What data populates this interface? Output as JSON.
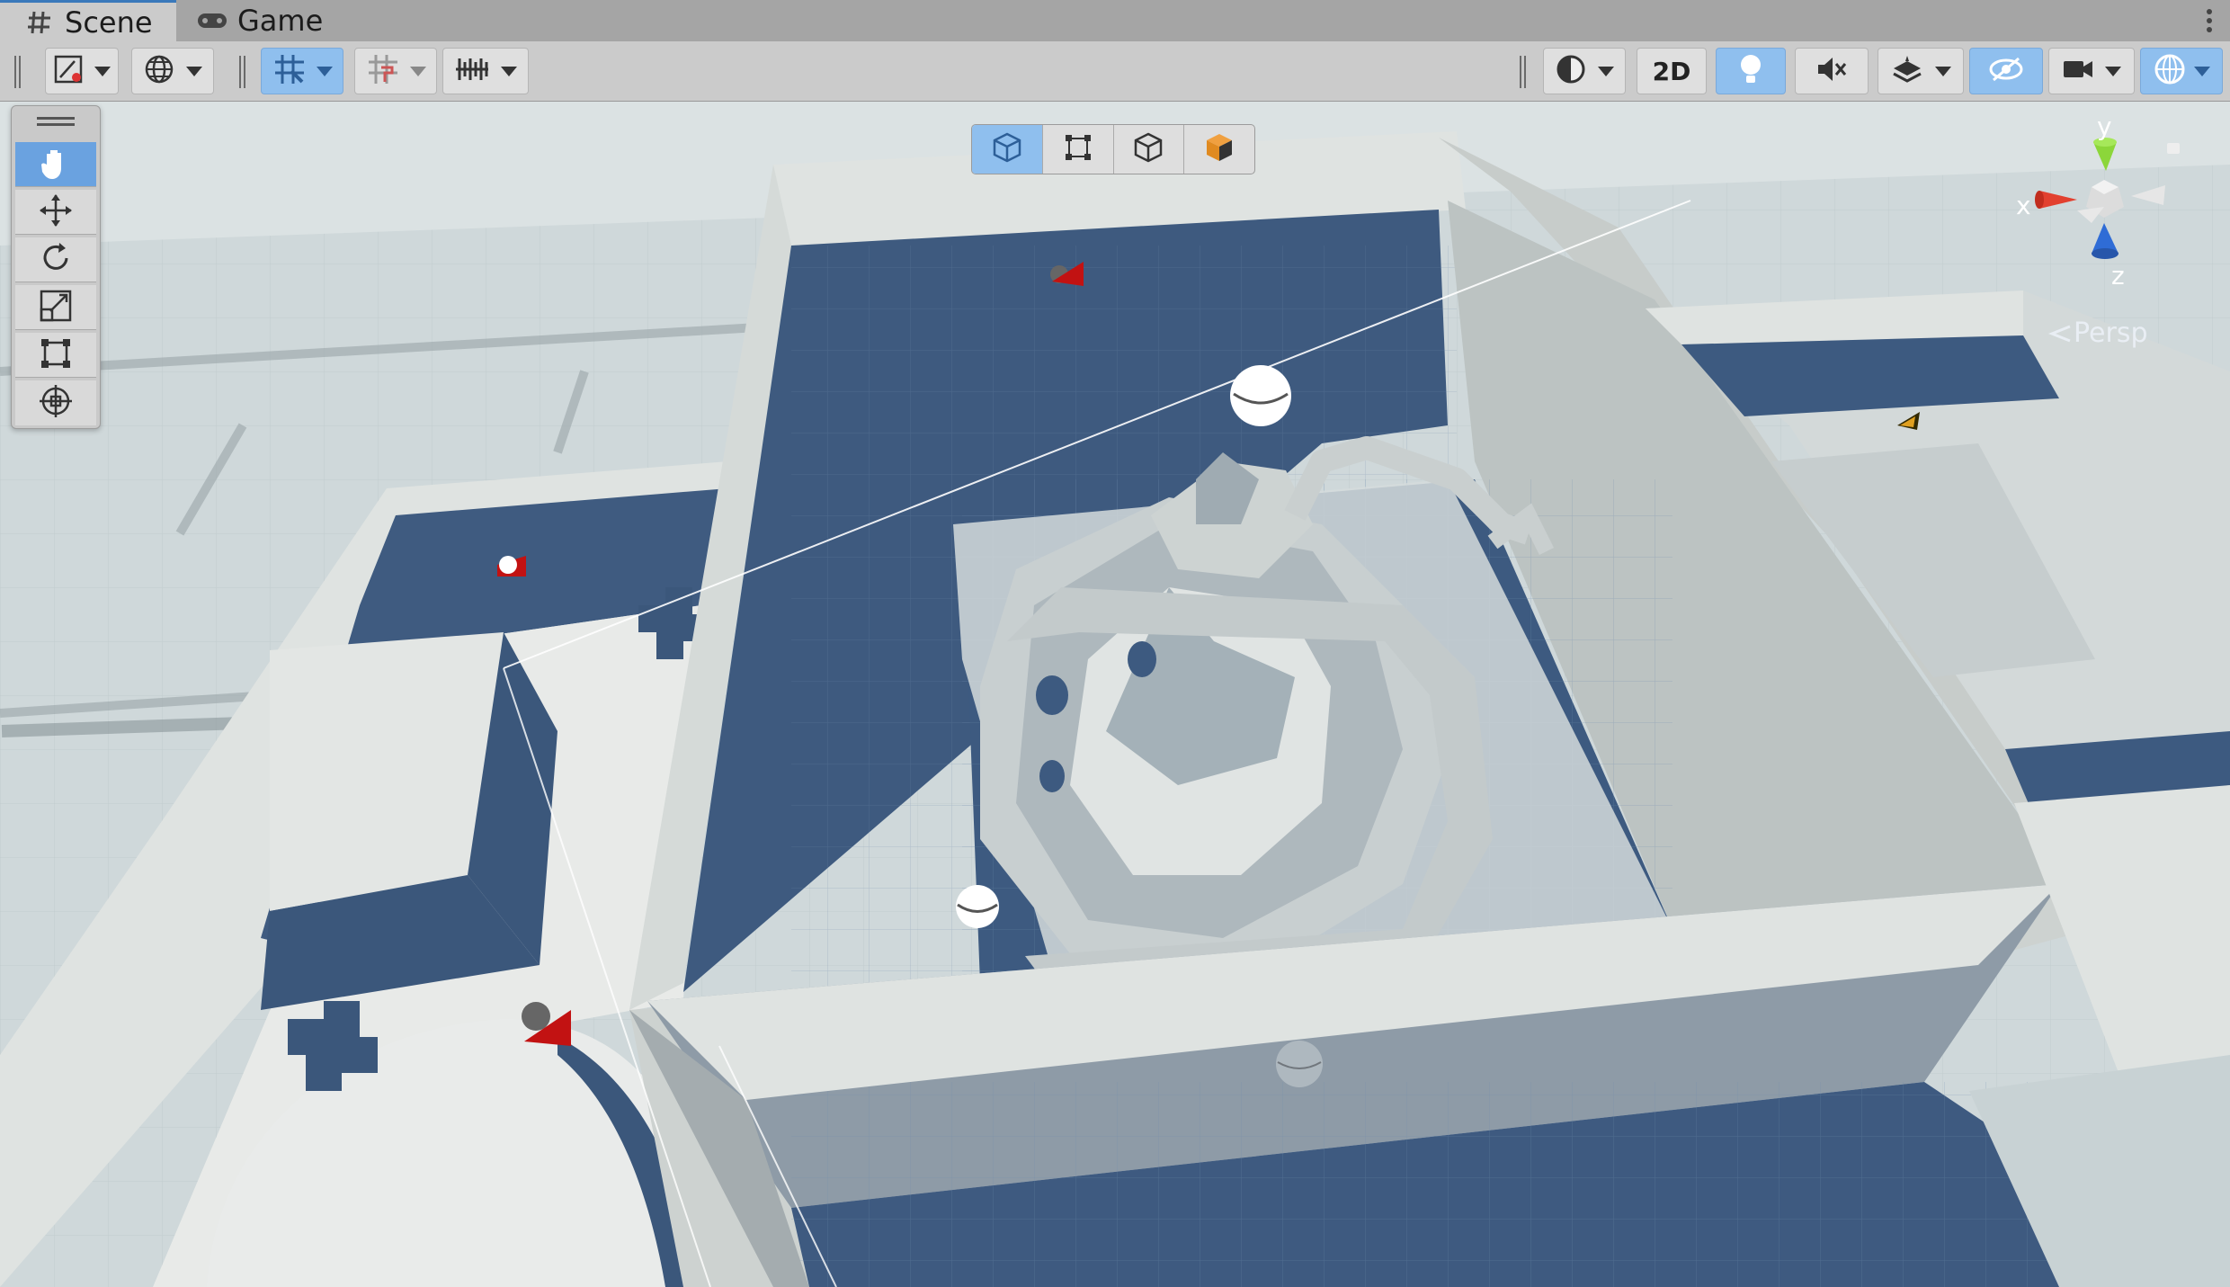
{
  "tabs": [
    {
      "label": "Scene",
      "icon": "grid-hash-icon",
      "active": true
    },
    {
      "label": "Game",
      "icon": "gamepad-icon",
      "active": false
    }
  ],
  "toolbar": {
    "left_groups": [
      "draw-mode-icon",
      "global-local-icon",
      "grid-snapping-icon",
      "increment-snap-icon",
      "ruler-snap-icon"
    ],
    "right_buttons": [
      "shading-mode-icon",
      "2D",
      "lighting-icon",
      "audio-mute-icon",
      "effects-layers-icon",
      "hidden-objects-icon",
      "camera-icon",
      "gizmos-icon"
    ],
    "mode_2d_label": "2D"
  },
  "tools": [
    "hand-tool-icon",
    "move-tool-icon",
    "rotate-tool-icon",
    "scale-tool-icon",
    "rect-tool-icon",
    "transform-tool-icon"
  ],
  "view_tools": [
    "cube-front-icon",
    "rect-view-icon",
    "cube-wire-icon",
    "cube-solid-icon"
  ],
  "gizmo": {
    "x": "x",
    "y": "y",
    "z": "z",
    "projection": "Persp"
  },
  "colors": {
    "accent": "#8fbfee",
    "active_tool": "#6aa2e0",
    "floor_blue": "#3d5a80",
    "wall_light": "#d6dcd9",
    "x_axis": "#e2402f",
    "y_axis": "#8cd63a",
    "z_axis": "#2f6cd6"
  }
}
